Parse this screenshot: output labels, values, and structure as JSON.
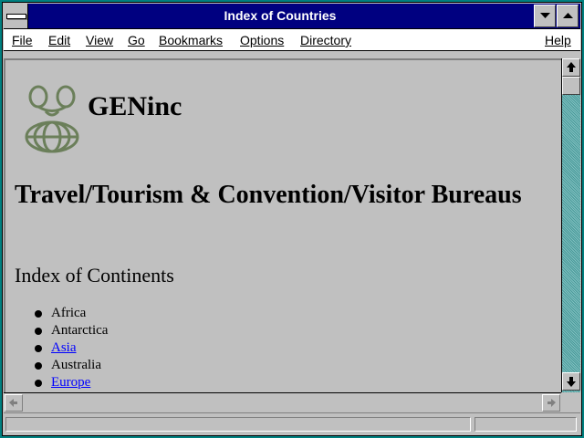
{
  "window": {
    "title": "Index of Countries"
  },
  "menu": {
    "file": "File",
    "edit": "Edit",
    "view": "View",
    "go": "Go",
    "bookmarks": "Bookmarks",
    "options": "Options",
    "directory": "Directory",
    "help": "Help"
  },
  "page": {
    "brand": "GENinc",
    "heading": "Travel/Tourism & Convention/Visitor Bureaus",
    "subheading": "Index of Continents",
    "continents": [
      {
        "label": "Africa",
        "link": false
      },
      {
        "label": "Antarctica",
        "link": false
      },
      {
        "label": "Asia",
        "link": true
      },
      {
        "label": "Australia",
        "link": false
      },
      {
        "label": "Europe",
        "link": true
      }
    ]
  },
  "colors": {
    "titlebar": "#000080",
    "link": "#0000ff",
    "logo": "#6b7f5a"
  },
  "icons": {
    "system_menu": "system-menu-icon",
    "minimize": "minimize-arrow-icon",
    "maximize": "maximize-arrow-icon",
    "scroll_up": "arrow-up-icon",
    "scroll_down": "arrow-down-icon",
    "scroll_left": "arrow-left-icon",
    "scroll_right": "arrow-right-icon",
    "logo": "genealogy-globe-logo"
  }
}
